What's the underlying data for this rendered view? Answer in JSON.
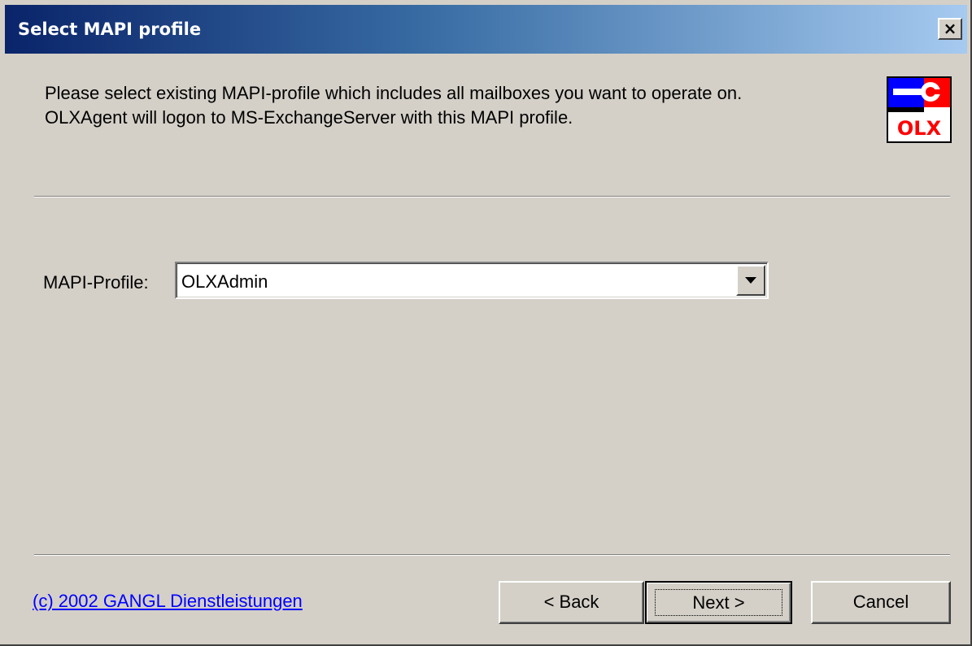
{
  "window": {
    "title": "Select MAPI profile",
    "close_label": "×"
  },
  "header": {
    "instruction_line1": "Please select existing MAPI-profile which includes all mailboxes you want to operate on.",
    "instruction_line2": "OLXAgent will logon to MS-ExchangeServer with this MAPI profile.",
    "logo_text": "OLX"
  },
  "form": {
    "profile_label": "MAPI-Profile:",
    "profile_value": "OLXAdmin"
  },
  "footer": {
    "copyright_link": "(c) 2002 GANGL Dienstleistungen",
    "back_label": "< Back",
    "next_label": "Next >",
    "cancel_label": "Cancel"
  },
  "colors": {
    "title_gradient_start": "#0a246a",
    "title_gradient_end": "#a6caf0",
    "dialog_face": "#d4d0c8",
    "link": "#0000ff",
    "logo_red": "#ff0000",
    "logo_blue": "#0000ff"
  }
}
